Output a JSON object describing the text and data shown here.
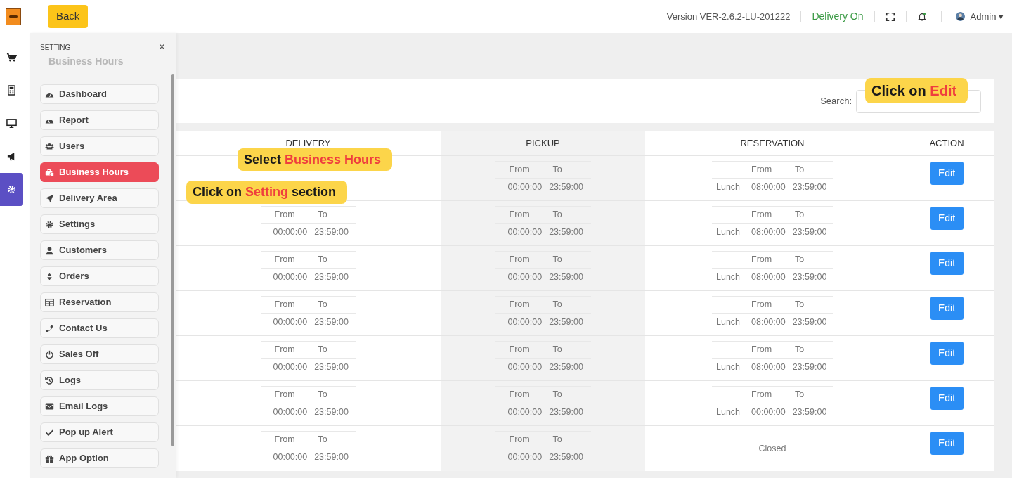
{
  "header": {
    "back": "Back",
    "version": "Version VER-2.6.2-LU-201222",
    "delivery_status": "Delivery On",
    "user": "Admin",
    "caret": "▾"
  },
  "nav_rail": [
    {
      "selected": false
    },
    {
      "selected": false
    },
    {
      "selected": false
    },
    {
      "selected": false
    },
    {
      "selected": true
    }
  ],
  "setting_panel": {
    "title": "SETTING",
    "close": "×",
    "page_title": "Business Hours",
    "items": [
      {
        "label": "Dashboard",
        "selected": false
      },
      {
        "label": "Report",
        "selected": false
      },
      {
        "label": "Users",
        "selected": false
      },
      {
        "label": "Business Hours",
        "selected": true
      },
      {
        "label": "Delivery Area",
        "selected": false
      },
      {
        "label": "Settings",
        "selected": false
      },
      {
        "label": "Customers",
        "selected": false
      },
      {
        "label": "Orders",
        "selected": false
      },
      {
        "label": "Reservation",
        "selected": false
      },
      {
        "label": "Contact Us",
        "selected": false
      },
      {
        "label": "Sales Off",
        "selected": false
      },
      {
        "label": "Logs",
        "selected": false
      },
      {
        "label": "Email Logs",
        "selected": false
      },
      {
        "label": "Pop up Alert",
        "selected": false
      },
      {
        "label": "App Option",
        "selected": false
      }
    ]
  },
  "search": {
    "label": "Search:"
  },
  "table": {
    "columns": [
      "DELIVERY",
      "PICKUP",
      "RESERVATION",
      "ACTION"
    ],
    "rows": [
      {
        "delivery": null,
        "pickup": {
          "from_label": "From",
          "to_label": "To",
          "from": "00:00:00",
          "to": "23:59:00"
        },
        "reservation": {
          "kind": "hours",
          "from_label": "From",
          "to_label": "To",
          "label": "Lunch",
          "from": "08:00:00",
          "to": "23:59:00"
        },
        "action": "Edit"
      },
      {
        "delivery": {
          "from_label": "From",
          "to_label": "To",
          "from": "00:00:00",
          "to": "23:59:00"
        },
        "pickup": {
          "from_label": "From",
          "to_label": "To",
          "from": "00:00:00",
          "to": "23:59:00"
        },
        "reservation": {
          "kind": "hours",
          "from_label": "From",
          "to_label": "To",
          "label": "Lunch",
          "from": "08:00:00",
          "to": "23:59:00"
        },
        "action": "Edit"
      },
      {
        "delivery": {
          "from_label": "From",
          "to_label": "To",
          "from": "00:00:00",
          "to": "23:59:00"
        },
        "pickup": {
          "from_label": "From",
          "to_label": "To",
          "from": "00:00:00",
          "to": "23:59:00"
        },
        "reservation": {
          "kind": "hours",
          "from_label": "From",
          "to_label": "To",
          "label": "Lunch",
          "from": "08:00:00",
          "to": "23:59:00"
        },
        "action": "Edit"
      },
      {
        "delivery": {
          "from_label": "From",
          "to_label": "To",
          "from": "00:00:00",
          "to": "23:59:00"
        },
        "pickup": {
          "from_label": "From",
          "to_label": "To",
          "from": "00:00:00",
          "to": "23:59:00"
        },
        "reservation": {
          "kind": "hours",
          "from_label": "From",
          "to_label": "To",
          "label": "Lunch",
          "from": "08:00:00",
          "to": "23:59:00"
        },
        "action": "Edit"
      },
      {
        "delivery": {
          "from_label": "From",
          "to_label": "To",
          "from": "00:00:00",
          "to": "23:59:00"
        },
        "pickup": {
          "from_label": "From",
          "to_label": "To",
          "from": "00:00:00",
          "to": "23:59:00"
        },
        "reservation": {
          "kind": "hours",
          "from_label": "From",
          "to_label": "To",
          "label": "Lunch",
          "from": "08:00:00",
          "to": "23:59:00"
        },
        "action": "Edit"
      },
      {
        "delivery": {
          "from_label": "From",
          "to_label": "To",
          "from": "00:00:00",
          "to": "23:59:00"
        },
        "pickup": {
          "from_label": "From",
          "to_label": "To",
          "from": "00:00:00",
          "to": "23:59:00"
        },
        "reservation": {
          "kind": "hours",
          "from_label": "From",
          "to_label": "To",
          "label": "Lunch",
          "from": "00:00:00",
          "to": "23:59:00"
        },
        "action": "Edit"
      },
      {
        "delivery": {
          "from_label": "From",
          "to_label": "To",
          "from": "00:00:00",
          "to": "23:59:00"
        },
        "pickup": {
          "from_label": "From",
          "to_label": "To",
          "from": "00:00:00",
          "to": "23:59:00"
        },
        "reservation": {
          "kind": "closed",
          "text": "Closed"
        },
        "action": "Edit"
      }
    ]
  },
  "callouts": [
    {
      "kind": "edit",
      "segments": [
        {
          "text": "Click on",
          "highlight": false
        },
        {
          "text": "Edit",
          "highlight": true
        }
      ]
    },
    {
      "kind": "business_hours",
      "segments": [
        {
          "text": "Select",
          "highlight": false
        },
        {
          "text": "Business Hours",
          "highlight": true
        }
      ]
    },
    {
      "kind": "setting",
      "segments": [
        {
          "text": "Click on",
          "highlight": false
        },
        {
          "text": "Setting",
          "highlight": true
        },
        {
          "text": "section",
          "highlight": false
        }
      ]
    }
  ]
}
